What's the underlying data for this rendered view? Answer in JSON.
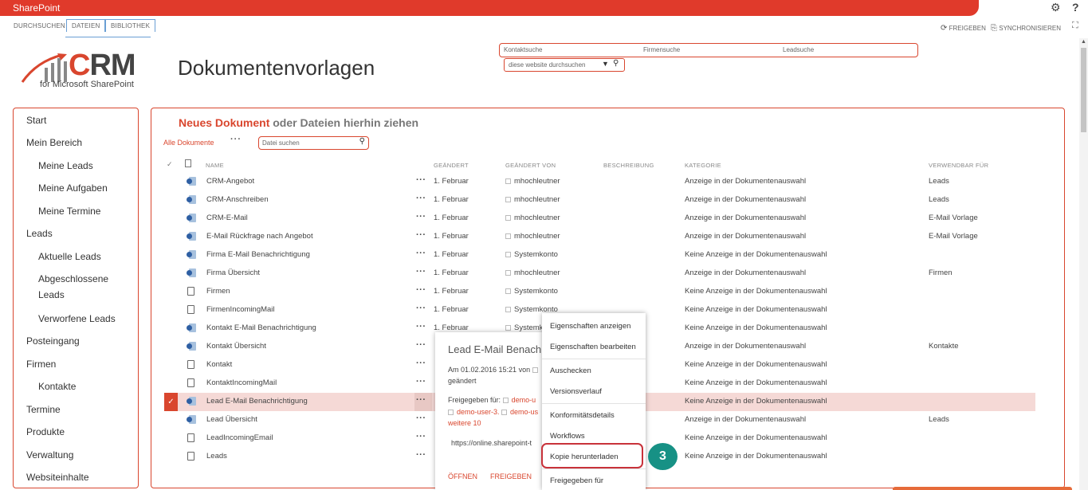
{
  "topbar": {
    "brand": "SharePoint"
  },
  "ribbon": {
    "tabs": [
      "DURCHSUCHEN",
      "DATEIEN",
      "BIBLIOTHEK"
    ],
    "share": "FREIGEBEN",
    "sync": "SYNCHRONISIEREN"
  },
  "logo": {
    "crm": "CRM",
    "sub": "for Microsoft SharePoint"
  },
  "page": {
    "title": "Dokumentenvorlagen"
  },
  "search": {
    "contact": "Kontaktsuche",
    "company": "Firmensuche",
    "lead": "Leadsuche",
    "site_placeholder": "diese website durchsuchen"
  },
  "nav": [
    {
      "label": "Start",
      "level": 0
    },
    {
      "label": "Mein Bereich",
      "level": 0
    },
    {
      "label": "Meine Leads",
      "level": 1
    },
    {
      "label": "Meine Aufgaben",
      "level": 1
    },
    {
      "label": "Meine Termine",
      "level": 1
    },
    {
      "label": "Leads",
      "level": 0
    },
    {
      "label": "Aktuelle Leads",
      "level": 1
    },
    {
      "label": "Abgeschlossene Leads",
      "level": 1
    },
    {
      "label": "Verworfene Leads",
      "level": 1
    },
    {
      "label": "Posteingang",
      "level": 0
    },
    {
      "label": "Firmen",
      "level": 0
    },
    {
      "label": "Kontakte",
      "level": 1
    },
    {
      "label": "Termine",
      "level": 0
    },
    {
      "label": "Produkte",
      "level": 0
    },
    {
      "label": "Verwaltung",
      "level": 0
    },
    {
      "label": "Websiteinhalte",
      "level": 0
    }
  ],
  "main": {
    "newdoc_bold": "Neues Dokument",
    "newdoc_rest": "oder Dateien hierhin ziehen",
    "all_docs": "Alle Dokumente",
    "file_search_placeholder": "Datei suchen"
  },
  "columns": [
    "NAME",
    "GEÄNDERT",
    "GEÄNDERT VON",
    "BESCHREIBUNG",
    "KATEGORIE",
    "VERWENDBAR FÜR"
  ],
  "rows": [
    {
      "name": "CRM-Angebot",
      "changed": "1. Februar",
      "by": "mhochleutner",
      "cat": "Anzeige in der Dokumentenauswahl",
      "use": "Leads",
      "icon": "word"
    },
    {
      "name": "CRM-Anschreiben",
      "changed": "1. Februar",
      "by": "mhochleutner",
      "cat": "Anzeige in der Dokumentenauswahl",
      "use": "Leads",
      "icon": "word"
    },
    {
      "name": "CRM-E-Mail",
      "changed": "1. Februar",
      "by": "mhochleutner",
      "cat": "Anzeige in der Dokumentenauswahl",
      "use": "E-Mail Vorlage",
      "icon": "word"
    },
    {
      "name": "E-Mail Rückfrage nach Angebot",
      "changed": "1. Februar",
      "by": "mhochleutner",
      "cat": "Anzeige in der Dokumentenauswahl",
      "use": "E-Mail Vorlage",
      "icon": "word"
    },
    {
      "name": "Firma E-Mail Benachrichtigung",
      "changed": "1. Februar",
      "by": "Systemkonto",
      "cat": "Keine Anzeige in der Dokumentenauswahl",
      "use": "",
      "icon": "word"
    },
    {
      "name": "Firma Übersicht",
      "changed": "1. Februar",
      "by": "mhochleutner",
      "cat": "Anzeige in der Dokumentenauswahl",
      "use": "Firmen",
      "icon": "word"
    },
    {
      "name": "Firmen",
      "changed": "1. Februar",
      "by": "Systemkonto",
      "cat": "Keine Anzeige in der Dokumentenauswahl",
      "use": "",
      "icon": "doc"
    },
    {
      "name": "FirmenIncomingMail",
      "changed": "1. Februar",
      "by": "Systemkonto",
      "cat": "Keine Anzeige in der Dokumentenauswahl",
      "use": "",
      "icon": "doc"
    },
    {
      "name": "Kontakt E-Mail Benachrichtigung",
      "changed": "1. Februar",
      "by": "Systemkonto",
      "cat": "Keine Anzeige in der Dokumentenauswahl",
      "use": "",
      "icon": "word"
    },
    {
      "name": "Kontakt Übersicht",
      "changed": "",
      "by": "",
      "cat": "Anzeige in der Dokumentenauswahl",
      "use": "Kontakte",
      "icon": "word"
    },
    {
      "name": "Kontakt",
      "changed": "",
      "by": "",
      "cat": "Keine Anzeige in der Dokumentenauswahl",
      "use": "",
      "icon": "doc"
    },
    {
      "name": "KontaktIncomingMail",
      "changed": "",
      "by": "",
      "cat": "Keine Anzeige in der Dokumentenauswahl",
      "use": "",
      "icon": "doc"
    },
    {
      "name": "Lead E-Mail Benachrichtigung",
      "changed": "",
      "by": "",
      "cat": "Keine Anzeige in der Dokumentenauswahl",
      "use": "",
      "icon": "word",
      "selected": true
    },
    {
      "name": "Lead Übersicht",
      "changed": "",
      "by": "",
      "cat": "Anzeige in der Dokumentenauswahl",
      "use": "Leads",
      "icon": "word"
    },
    {
      "name": "LeadIncomingEmail",
      "changed": "",
      "by": "",
      "cat": "Keine Anzeige in der Dokumentenauswahl",
      "use": "",
      "icon": "doc"
    },
    {
      "name": "Leads",
      "changed": "",
      "by": "",
      "cat": "Keine Anzeige in der Dokumentenauswahl",
      "use": "",
      "icon": "doc"
    }
  ],
  "callout": {
    "title": "Lead E-Mail Benach",
    "modified_line": "Am 01.02.2016 15:21 von",
    "modified_line2": "geändert",
    "shared_label": "Freigegeben für:",
    "user1": "demo-u",
    "user2": "demo-user-3.",
    "user3": "demo-us",
    "more": "weitere 10",
    "url": "https://online.sharepoint-t",
    "open": "ÖFFNEN",
    "share": "FREIGEBEN"
  },
  "context_menu": [
    "Eigenschaften anzeigen",
    "Eigenschaften bearbeiten",
    "Auschecken",
    "Versionsverlauf",
    "Konformitätsdetails",
    "Workflows",
    "Kopie herunterladen",
    "Freigegeben für"
  ],
  "badge": "3",
  "colors": {
    "accent": "#d9462e",
    "badge": "#179185",
    "selected_row": "#f5d9d6"
  }
}
